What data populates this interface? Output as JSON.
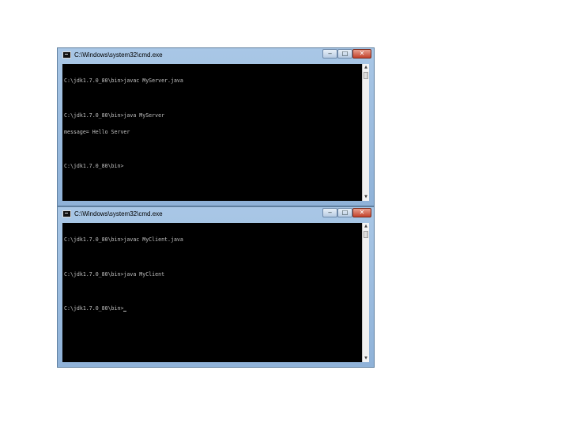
{
  "windows": [
    {
      "title": "C:\\Windows\\system32\\cmd.exe",
      "controls": {
        "minimize": "‒",
        "maximize": "□",
        "close": "✕"
      },
      "lines": [
        "C:\\jdk1.7.0_80\\bin>javac MyServer.java",
        "",
        "C:\\jdk1.7.0_80\\bin>java MyServer",
        "message= Hello Server",
        "",
        "C:\\jdk1.7.0_80\\bin>"
      ]
    },
    {
      "title": "C:\\Windows\\system32\\cmd.exe",
      "controls": {
        "minimize": "‒",
        "maximize": "□",
        "close": "✕"
      },
      "lines": [
        "C:\\jdk1.7.0_80\\bin>javac MyClient.java",
        "",
        "C:\\jdk1.7.0_80\\bin>java MyClient",
        "",
        "C:\\jdk1.7.0_80\\bin>"
      ]
    }
  ],
  "scroll_arrows": {
    "up": "▲",
    "down": "▼"
  }
}
